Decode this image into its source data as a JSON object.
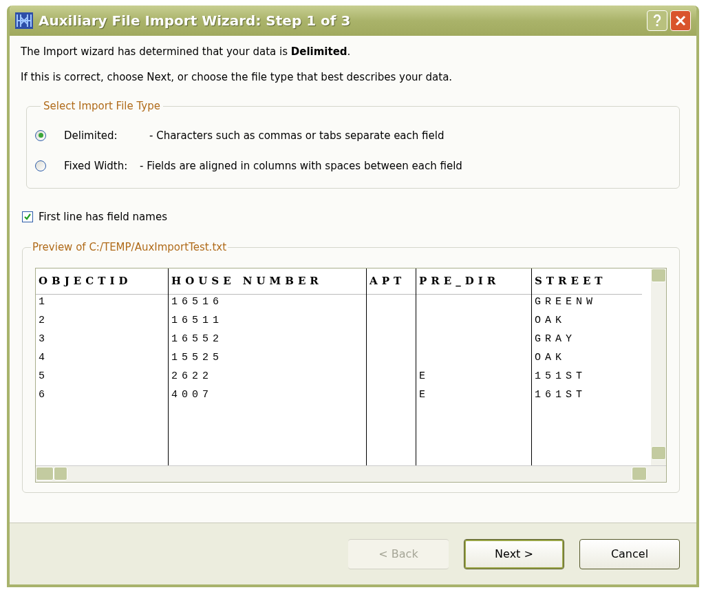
{
  "window": {
    "title": "Auxiliary File Import Wizard: Step 1 of 3"
  },
  "intro": [
    "The Import wizard has determined that your data is **Delimited**.",
    "If this is correct, choose Next, or choose the file type that best describes your data."
  ],
  "file_type_group": {
    "legend": "Select Import File Type",
    "options": [
      {
        "label": "Delimited:",
        "description": "- Characters such as commas or tabs separate each field",
        "selected": true
      },
      {
        "label": "Fixed Width:",
        "description": "- Fields are aligned in columns with spaces between each field",
        "selected": false
      }
    ]
  },
  "first_line_names": {
    "label": "First line has field names",
    "checked": true
  },
  "preview": {
    "legend": "Preview of C:/TEMP/AuxImportTest.txt",
    "columns": [
      "OBJECTID",
      "HOUSE NUMBER",
      "APT",
      "PRE_DIR",
      "STREET"
    ],
    "rows": [
      [
        "1",
        "16516",
        null,
        null,
        "GREENW"
      ],
      [
        "2",
        "16511",
        null,
        null,
        "OAK"
      ],
      [
        "3",
        "16552",
        null,
        null,
        "GRAY"
      ],
      [
        "4",
        "15525",
        null,
        null,
        "OAK"
      ],
      [
        "5",
        "2622",
        null,
        "E",
        "151ST"
      ],
      [
        "6",
        "4007",
        null,
        "E",
        "161ST"
      ]
    ]
  },
  "buttons": [
    {
      "label": "< Back",
      "disabled": true,
      "default": false
    },
    {
      "label": "Next >",
      "disabled": false,
      "default": true
    },
    {
      "label": "Cancel",
      "disabled": false,
      "default": false
    }
  ]
}
